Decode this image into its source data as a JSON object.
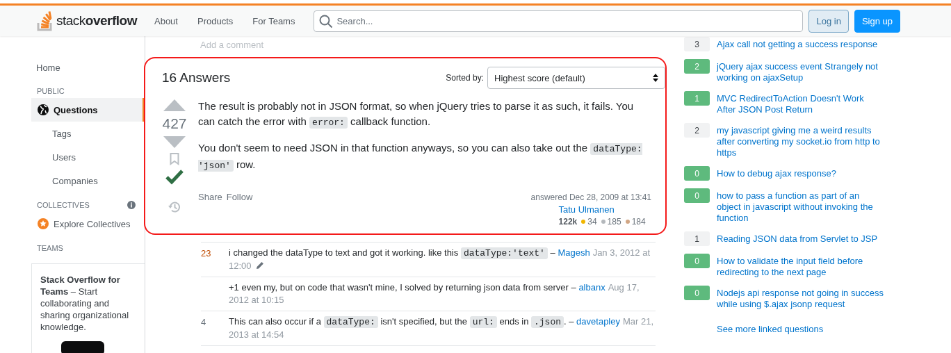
{
  "header": {
    "logo": "stack**overflow**",
    "nav": [
      "About",
      "Products",
      "For Teams"
    ],
    "search": {
      "placeholder": "Search..."
    },
    "login": "Log in",
    "signup": "Sign up"
  },
  "sidebar": {
    "home": "Home",
    "sections": [
      {
        "title": "PUBLIC",
        "info": false,
        "items": [
          {
            "kind": "main",
            "label": "Questions",
            "selected": true
          },
          {
            "kind": "sub",
            "label": "Tags",
            "selected": false
          },
          {
            "kind": "sub",
            "label": "Users",
            "selected": false
          },
          {
            "kind": "sub",
            "label": "Companies",
            "selected": false
          }
        ]
      },
      {
        "title": "COLLECTIVES",
        "info": true,
        "items": [
          {
            "kind": "collective",
            "label": "Explore Collectives",
            "selected": false
          }
        ]
      },
      {
        "title": "TEAMS",
        "info": false
      }
    ],
    "teams_card": {
      "text": "**Stack Overflow for Teams** – Start collaborating and sharing organizational knowledge."
    }
  },
  "add_comment": "Add a comment",
  "answers": {
    "count_label": "16 Answers",
    "sort_label": "Sorted by:",
    "sort_value": "Highest score (default)",
    "highlighted": true,
    "answer": {
      "score": "427",
      "accepted": true,
      "paragraphs": [
        [
          {
            "kind": "text",
            "text": "The result is probably not in JSON format, so when jQuery tries to parse it as such, it fails. You can catch the error with "
          },
          {
            "kind": "code",
            "text": "error:"
          },
          {
            "kind": "text",
            "text": " callback function."
          }
        ],
        [
          {
            "kind": "text",
            "text": "You don't seem to need JSON in that function anyways, so you can also take out the "
          },
          {
            "kind": "code",
            "text": "dataType: 'json'"
          },
          {
            "kind": "text",
            "text": " row."
          }
        ]
      ],
      "actions": [
        "Share",
        "Follow"
      ],
      "answered": "answered Dec 28, 2009 at 13:41",
      "author": "Tatu Ulmanen",
      "reputation": "122k",
      "badges": [
        {
          "color": "#f1b600",
          "count": "34"
        },
        {
          "color": "#b4b8bc",
          "count": "185"
        },
        {
          "color": "#d1a684",
          "count": "184"
        }
      ]
    }
  },
  "comments": [
    {
      "score": "23",
      "hot": true,
      "edited": true,
      "segments": [
        {
          "kind": "text",
          "text": "i changed the dataType to text and got it working. like this "
        },
        {
          "kind": "code",
          "text": "dataType:'text'"
        },
        {
          "kind": "text",
          "text": " – "
        },
        {
          "kind": "user",
          "text": "Magesh"
        },
        {
          "kind": "date",
          "text": "Jan 3, 2012 at 12:00"
        }
      ]
    },
    {
      "edited": false,
      "segments": [
        {
          "kind": "text",
          "text": "+1 even my, but on code that wasn't mine, I solved by returning json data from server – "
        },
        {
          "kind": "user",
          "text": "albanx"
        },
        {
          "kind": "date",
          "text": "Aug 17, 2012 at 10:15"
        }
      ]
    },
    {
      "score": "4",
      "hot": false,
      "edited": false,
      "segments": [
        {
          "kind": "text",
          "text": "This can also occur if a "
        },
        {
          "kind": "code",
          "text": "dataType:"
        },
        {
          "kind": "text",
          "text": " isn't specified, but the "
        },
        {
          "kind": "code",
          "text": "url:"
        },
        {
          "kind": "text",
          "text": " ends in "
        },
        {
          "kind": "code",
          "text": ".json"
        },
        {
          "kind": "text",
          "text": ". – "
        },
        {
          "kind": "user",
          "text": "davetapley"
        },
        {
          "kind": "date",
          "text": "Mar 21, 2013 at 14:54"
        }
      ]
    }
  ],
  "linked": {
    "items": [
      {
        "score": "3",
        "accepted": false,
        "title": "Ajax call not getting a success response"
      },
      {
        "score": "2",
        "accepted": true,
        "title": "jQuery ajax success event Strangely not working on ajaxSetup"
      },
      {
        "score": "1",
        "accepted": true,
        "title": "MVC RedirectToAction Doesn't Work After JSON Post Return"
      },
      {
        "score": "2",
        "accepted": false,
        "title": "my javascript giving me a weird results after converting my socket.io from http to https"
      },
      {
        "score": "0",
        "accepted": true,
        "title": "How to debug ajax response?"
      },
      {
        "score": "0",
        "accepted": true,
        "title": "how to pass a function as part of an object in javascript without invoking the function"
      },
      {
        "score": "1",
        "accepted": false,
        "title": "Reading JSON data from Servlet to JSP"
      },
      {
        "score": "0",
        "accepted": true,
        "title": "How to validate the input field before redirecting to the next page"
      },
      {
        "score": "0",
        "accepted": true,
        "title": "Nodejs api response not going in success while using $.ajax jsonp request"
      }
    ],
    "more": "See more linked questions"
  }
}
